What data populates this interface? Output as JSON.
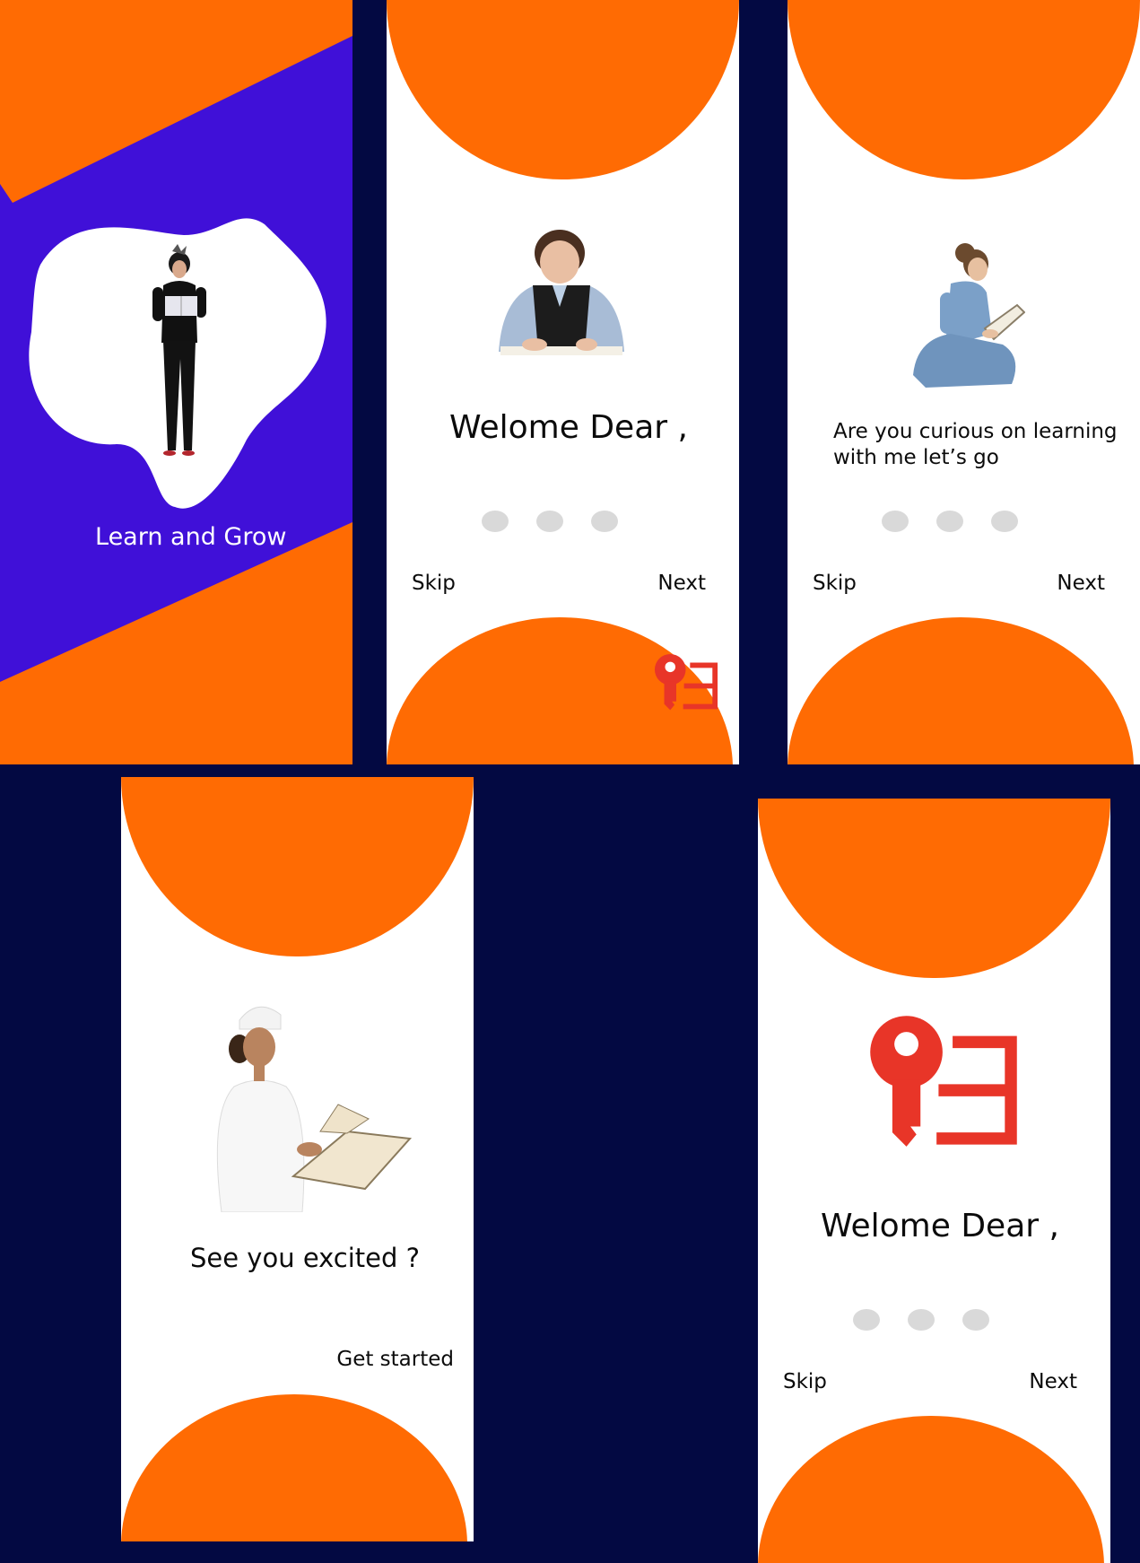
{
  "colors": {
    "background": "#030942",
    "accent_orange": "#ff6b03",
    "splash_purple": "#4010d8",
    "key_red": "#e83528",
    "dot_grey": "#d9d9d9"
  },
  "icons": {
    "logo": "key-with-lines-icon"
  },
  "screen1": {
    "caption": "Learn and Grow"
  },
  "screen2": {
    "title": "Welome Dear ,",
    "skip_label": "Skip",
    "next_label": "Next",
    "page_count": 3
  },
  "screen3": {
    "title_line1": "Are you curious on learning",
    "title_line2": "with me let’s go",
    "skip_label": "Skip",
    "next_label": "Next",
    "page_count": 3
  },
  "screen4": {
    "title": "See you excited ?",
    "cta_label": "Get started"
  },
  "screen5": {
    "title": "Welome Dear ,",
    "skip_label": "Skip",
    "next_label": "Next",
    "page_count": 3
  }
}
